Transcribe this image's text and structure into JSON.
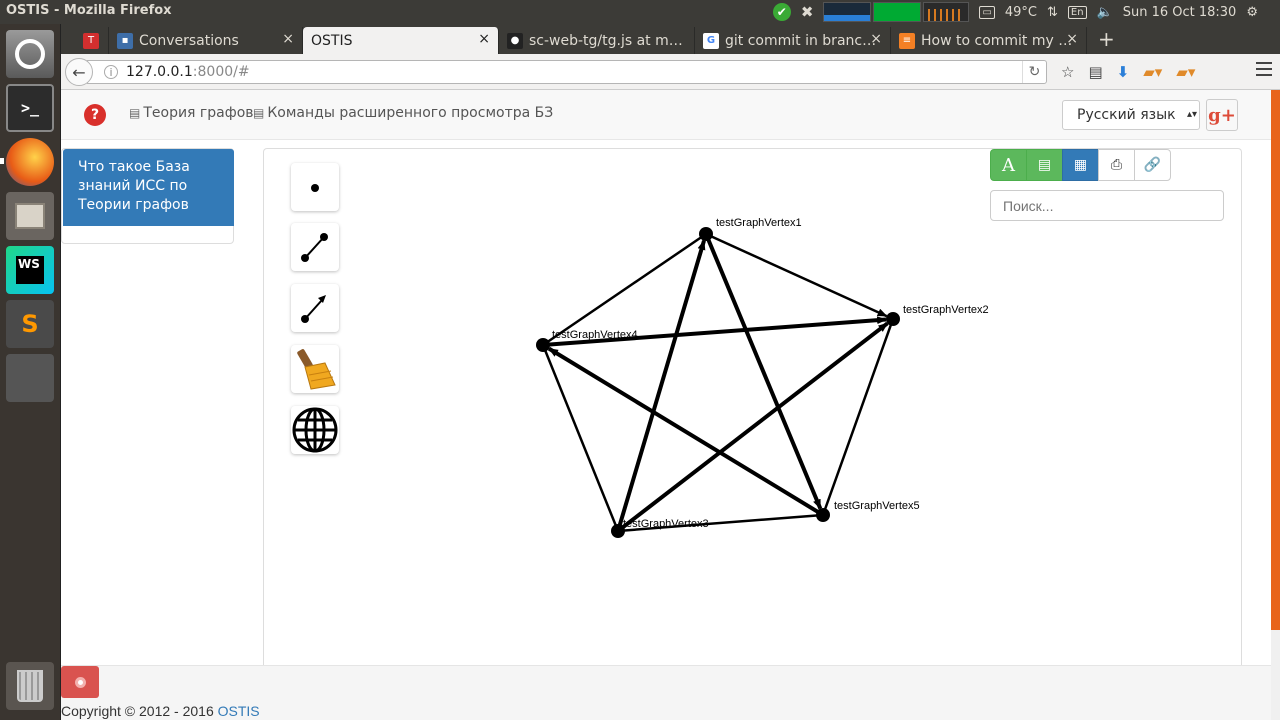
{
  "os": {
    "window_title": "OSTIS - Mozilla Firefox",
    "temperature": "49°C",
    "keyboard_layout": "En",
    "clock": "Sun 16 Oct 18:30"
  },
  "launcher": [
    {
      "name": "ubuntu-dash",
      "icon": "ubuntu-logo-icon"
    },
    {
      "name": "terminal",
      "icon": "terminal-icon",
      "label": ">_"
    },
    {
      "name": "firefox",
      "icon": "firefox-icon"
    },
    {
      "name": "files",
      "icon": "file-cabinet-icon"
    },
    {
      "name": "webstorm",
      "icon": "webstorm-icon",
      "label": "WS"
    },
    {
      "name": "sublime-text",
      "icon": "sublime-icon",
      "label": "S"
    },
    {
      "name": "workspaces",
      "icon": "workspace-switcher-icon"
    },
    {
      "name": "trash",
      "icon": "trash-icon"
    }
  ],
  "tabs": [
    {
      "label": "",
      "icon_text": "T",
      "icon_color": "#d32f2f"
    },
    {
      "label": "Conversations",
      "icon_text": "▪",
      "icon_color": "#3e6ea8"
    },
    {
      "label": "OSTIS",
      "active": true
    },
    {
      "label": "sc-web-tg/tg.js at m…",
      "icon_text": "●",
      "icon_color": "#222222"
    },
    {
      "label": "git commit in branc…",
      "icon_text": "G",
      "icon_color": "#4285f4"
    },
    {
      "label": "How to commit my …",
      "icon_text": "≡",
      "icon_color": "#f48024"
    }
  ],
  "address": {
    "host": "127.0.0.1",
    "rest": ":8000/#"
  },
  "header": {
    "menu": [
      "Теория графов",
      "Команды расширенного просмотра БЗ"
    ],
    "language": "Русский язык",
    "gplus_label": "g+"
  },
  "history": {
    "item": "Что такое База знаний ИСС по Теории графов"
  },
  "view_modes": {
    "text_label": "A"
  },
  "search": {
    "placeholder": "Поиск..."
  },
  "tools": [
    {
      "name": "vertex-tool",
      "icon": "dot-icon"
    },
    {
      "name": "edge-tool",
      "icon": "edge-icon"
    },
    {
      "name": "arc-tool",
      "icon": "arc-icon"
    },
    {
      "name": "clear-tool",
      "icon": "broom-icon"
    },
    {
      "name": "globe-tool",
      "icon": "globe-icon"
    }
  ],
  "graph": {
    "vertices": [
      {
        "id": "v1",
        "label": "testGraphVertex1"
      },
      {
        "id": "v2",
        "label": "testGraphVertex2"
      },
      {
        "id": "v3",
        "label": "testGraphVertex3"
      },
      {
        "id": "v4",
        "label": "testGraphVertex4"
      },
      {
        "id": "v5",
        "label": "testGraphVertex5"
      }
    ],
    "edges": [
      {
        "from": "v4",
        "to": "v1",
        "directed": false
      },
      {
        "from": "v1",
        "to": "v2",
        "directed": true
      },
      {
        "from": "v2",
        "to": "v5",
        "directed": false
      },
      {
        "from": "v3",
        "to": "v5",
        "directed": false
      },
      {
        "from": "v3",
        "to": "v4",
        "directed": false
      },
      {
        "from": "v1",
        "to": "v5",
        "directed": true
      },
      {
        "from": "v3",
        "to": "v1",
        "directed": true
      },
      {
        "from": "v4",
        "to": "v2",
        "directed": true
      },
      {
        "from": "v3",
        "to": "v2",
        "directed": true
      },
      {
        "from": "v5",
        "to": "v4",
        "directed": true
      }
    ]
  },
  "footer": {
    "copyright": "Copyright © 2012 - 2016 ",
    "link": "OSTIS"
  },
  "colors": {
    "accent_blue": "#337ab7",
    "green": "#5cb85c",
    "danger": "#d9534f"
  }
}
